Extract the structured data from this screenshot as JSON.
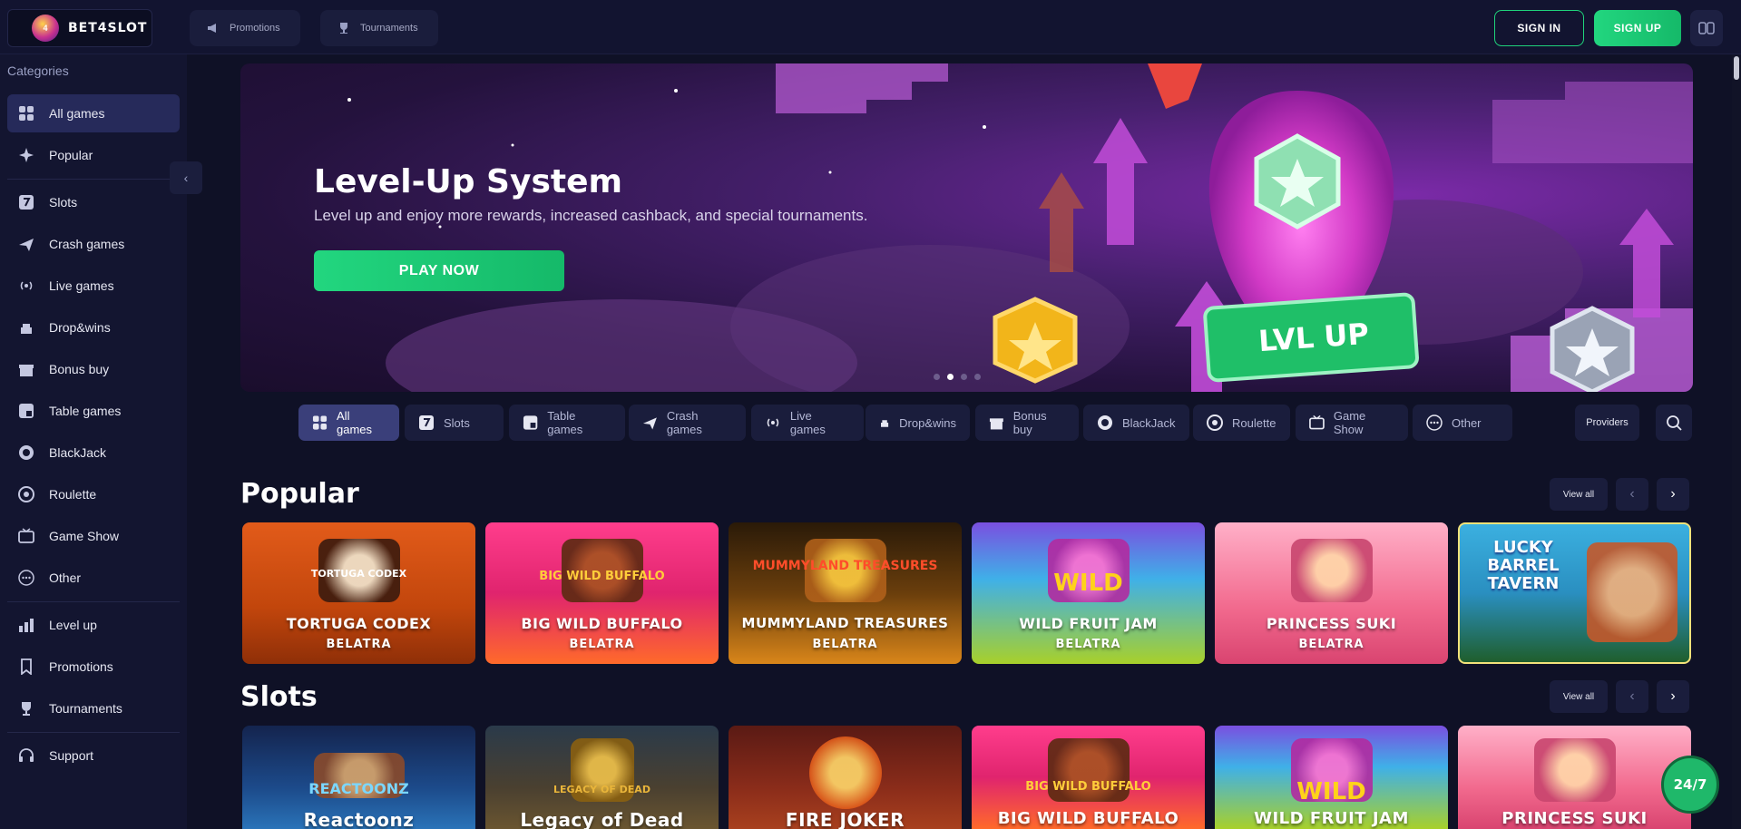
{
  "header": {
    "logo_text": "BET4SLOT",
    "logo_badge": "4",
    "promotions_label": "Promotions",
    "tournaments_label": "Tournaments",
    "signin_label": "SIGN IN",
    "signup_label": "SIGN UP"
  },
  "sidebar": {
    "categories_label": "Categories",
    "items": [
      {
        "label": "All games",
        "icon": "grid-icon"
      },
      {
        "label": "Popular",
        "icon": "sparkle-icon"
      },
      {
        "label": "Slots",
        "icon": "seven-icon"
      },
      {
        "label": "Crash games",
        "icon": "plane-icon"
      },
      {
        "label": "Live games",
        "icon": "broadcast-icon"
      },
      {
        "label": "Drop&wins",
        "icon": "drop-icon"
      },
      {
        "label": "Bonus buy",
        "icon": "gift-icon"
      },
      {
        "label": "Table games",
        "icon": "dice-icon"
      },
      {
        "label": "BlackJack",
        "icon": "chip-icon"
      },
      {
        "label": "Roulette",
        "icon": "roulette-icon"
      },
      {
        "label": "Game Show",
        "icon": "tv-icon"
      },
      {
        "label": "Other",
        "icon": "dots-icon"
      },
      {
        "label": "Level up",
        "icon": "levels-icon"
      },
      {
        "label": "Promotions",
        "icon": "bookmark-icon"
      },
      {
        "label": "Tournaments",
        "icon": "trophy-icon"
      },
      {
        "label": "Support",
        "icon": "headset-icon"
      }
    ]
  },
  "banner": {
    "title": "Level-Up System",
    "subtitle": "Level up and enjoy more rewards, increased cashback, and special tournaments.",
    "cta": "PLAY NOW",
    "badge_text": "LVL UP"
  },
  "tabs": [
    {
      "label": "All games"
    },
    {
      "label": "Slots"
    },
    {
      "label": "Table games"
    },
    {
      "label": "Crash games"
    },
    {
      "label": "Live games"
    },
    {
      "label": "Drop&wins"
    },
    {
      "label": "Bonus buy"
    },
    {
      "label": "BlackJack"
    },
    {
      "label": "Roulette"
    },
    {
      "label": "Game Show"
    },
    {
      "label": "Other"
    }
  ],
  "providers_label": "Providers",
  "sections": {
    "popular": {
      "title": "Popular",
      "view_all": "View all",
      "games": [
        {
          "name": "TORTUGA CODEX",
          "provider": "BELATRA",
          "logo": "TORTUGA CODEX"
        },
        {
          "name": "BIG WILD BUFFALO",
          "provider": "BELATRA",
          "logo": "BIG WILD BUFFALO"
        },
        {
          "name": "MUMMYLAND TREASURES",
          "provider": "BELATRA",
          "logo": "MUMMYLAND TREASURES"
        },
        {
          "name": "WILD FRUIT JAM",
          "provider": "BELATRA",
          "logo": "WILD"
        },
        {
          "name": "PRINCESS SUKI",
          "provider": "BELATRA",
          "logo": ""
        },
        {
          "name": "",
          "provider": "",
          "logo": "LUCKY BARREL TAVERN"
        }
      ]
    },
    "slots": {
      "title": "Slots",
      "view_all": "View all",
      "games": [
        {
          "name": "Reactoonz",
          "logo": "REACTOONZ"
        },
        {
          "name": "Legacy of Dead",
          "logo": "LEGACY OF DEAD"
        },
        {
          "name": "FIRE JOKER",
          "logo": ""
        },
        {
          "name": "BIG WILD BUFFALO",
          "logo": "BIG WILD BUFFALO"
        },
        {
          "name": "WILD FRUIT JAM",
          "logo": "WILD"
        },
        {
          "name": "PRINCESS SUKI",
          "logo": ""
        }
      ]
    }
  },
  "support_bubble": "24/7",
  "colors": {
    "accent": "#22d67f",
    "bg": "#0f1126",
    "sidebar": "#131530"
  }
}
